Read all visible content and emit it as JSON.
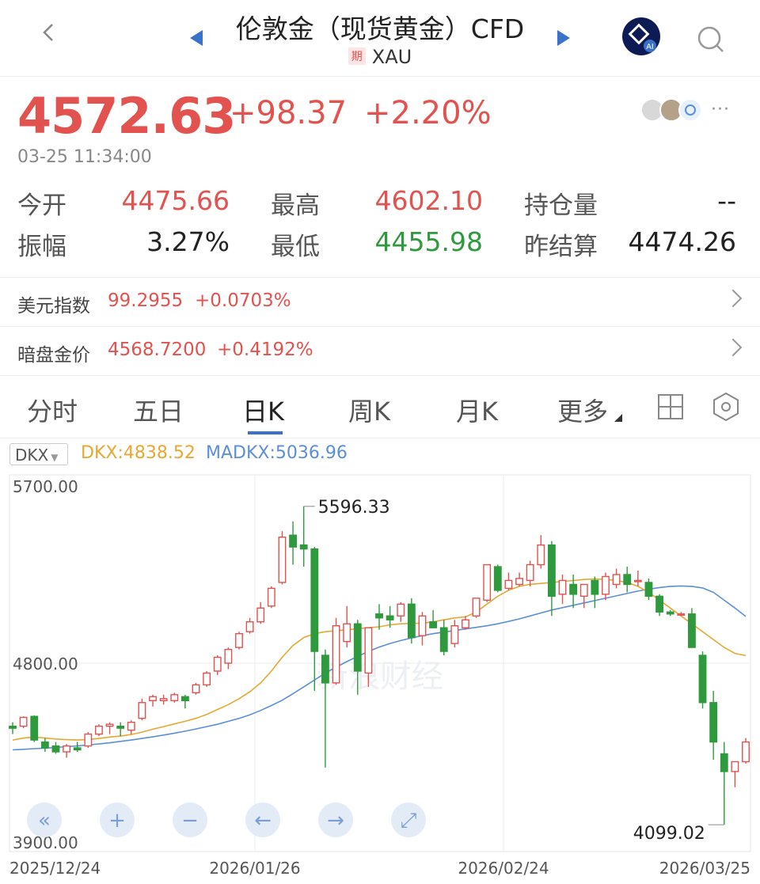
{
  "header": {
    "title": "伦敦金（现货黄金）CFD",
    "badge": "期",
    "symbol": "XAU"
  },
  "quote": {
    "price": "4572.63",
    "change": "+98.37",
    "change_pct": "+2.20%",
    "time": "03-25 11:34:00",
    "more": "···"
  },
  "stats": [
    {
      "label": "今开",
      "value": "4475.66",
      "color": "red"
    },
    {
      "label": "最高",
      "value": "4602.10",
      "color": "red"
    },
    {
      "label": "持仓量",
      "value": "--",
      "color": "blk"
    },
    {
      "label": "振幅",
      "value": "3.27%",
      "color": "blk"
    },
    {
      "label": "最低",
      "value": "4455.98",
      "color": "green"
    },
    {
      "label": "昨结算",
      "value": "4474.26",
      "color": "blk"
    }
  ],
  "related": [
    {
      "label": "美元指数",
      "value": "99.2955",
      "change": "+0.0703%"
    },
    {
      "label": "暗盘金价",
      "value": "4568.7200",
      "change": "+0.4192%"
    }
  ],
  "tabs": [
    "分时",
    "五日",
    "日K",
    "周K",
    "月K",
    "更多"
  ],
  "indicator": {
    "name": "DKX",
    "dkx": "DKX:4838.52",
    "madkx": "MADKX:5036.96"
  },
  "chart_data": {
    "type": "candlestick",
    "ylim": [
      3900,
      5700
    ],
    "y_ticks": [
      "5700.00",
      "4800.00",
      "3900.00"
    ],
    "x_ticks": [
      "2025/12/24",
      "2026/01/26",
      "2026/02/24",
      "2026/03/25"
    ],
    "high_label": "5596.33",
    "low_label": "4099.02",
    "watermark": "新浪财经",
    "candles": [
      [
        4480,
        4500,
        4440,
        4470
      ],
      [
        4480,
        4530,
        4470,
        4525
      ],
      [
        4530,
        4535,
        4400,
        4410
      ],
      [
        4400,
        4420,
        4350,
        4370
      ],
      [
        4380,
        4400,
        4340,
        4350
      ],
      [
        4350,
        4390,
        4320,
        4380
      ],
      [
        4370,
        4400,
        4350,
        4360
      ],
      [
        4380,
        4450,
        4370,
        4440
      ],
      [
        4440,
        4490,
        4430,
        4480
      ],
      [
        4480,
        4500,
        4440,
        4490
      ],
      [
        4480,
        4500,
        4430,
        4470
      ],
      [
        4460,
        4510,
        4440,
        4500
      ],
      [
        4520,
        4620,
        4510,
        4600
      ],
      [
        4610,
        4640,
        4580,
        4630
      ],
      [
        4610,
        4640,
        4590,
        4620
      ],
      [
        4610,
        4650,
        4600,
        4640
      ],
      [
        4630,
        4640,
        4570,
        4610
      ],
      [
        4650,
        4700,
        4640,
        4690
      ],
      [
        4690,
        4760,
        4680,
        4750
      ],
      [
        4760,
        4840,
        4740,
        4830
      ],
      [
        4800,
        4880,
        4770,
        4870
      ],
      [
        4880,
        4960,
        4870,
        4950
      ],
      [
        4960,
        5030,
        4950,
        5010
      ],
      [
        5010,
        5110,
        5000,
        5080
      ],
      [
        5090,
        5190,
        5080,
        5180
      ],
      [
        5210,
        5470,
        5200,
        5440
      ],
      [
        5450,
        5520,
        5300,
        5390
      ],
      [
        5400,
        5596.33,
        5290,
        5380
      ],
      [
        5380,
        5390,
        4660,
        4860
      ],
      [
        4840,
        4870,
        4270,
        4700
      ],
      [
        4700,
        5030,
        4690,
        4990
      ],
      [
        4910,
        5090,
        4880,
        5000
      ],
      [
        5000,
        5020,
        4640,
        4760
      ],
      [
        4750,
        4980,
        4680,
        4980
      ],
      [
        5050,
        5100,
        4970,
        5030
      ],
      [
        5040,
        5090,
        4980,
        5020
      ],
      [
        5040,
        5110,
        5010,
        5100
      ],
      [
        5100,
        5130,
        4900,
        4930
      ],
      [
        4940,
        5060,
        4890,
        5040
      ],
      [
        5010,
        5070,
        4980,
        4980
      ],
      [
        4980,
        5020,
        4840,
        4860
      ],
      [
        4900,
        5020,
        4880,
        4990
      ],
      [
        4980,
        5040,
        4970,
        5020
      ],
      [
        5040,
        5110,
        5030,
        5130
      ],
      [
        5120,
        5300,
        5110,
        5300
      ],
      [
        5290,
        5300,
        5160,
        5170
      ],
      [
        5180,
        5260,
        5170,
        5220
      ],
      [
        5200,
        5260,
        5190,
        5230
      ],
      [
        5220,
        5320,
        5190,
        5300
      ],
      [
        5300,
        5450,
        5280,
        5400
      ],
      [
        5400,
        5420,
        5040,
        5140
      ],
      [
        5150,
        5250,
        5100,
        5220
      ],
      [
        5200,
        5250,
        5080,
        5150
      ],
      [
        5140,
        5200,
        5080,
        5200
      ],
      [
        5220,
        5240,
        5080,
        5150
      ],
      [
        5150,
        5260,
        5120,
        5240
      ],
      [
        5200,
        5280,
        5180,
        5250
      ],
      [
        5250,
        5290,
        5160,
        5200
      ],
      [
        5220,
        5270,
        5190,
        5220
      ],
      [
        5210,
        5230,
        5120,
        5140
      ],
      [
        5140,
        5150,
        5040,
        5060
      ],
      [
        5060,
        5070,
        5040,
        5050
      ],
      [
        5050,
        5060,
        5040,
        5050
      ],
      [
        5050,
        5080,
        4880,
        4880
      ],
      [
        4840,
        4860,
        4570,
        4600
      ],
      [
        4600,
        4660,
        4310,
        4400
      ],
      [
        4340,
        4400,
        3980,
        4250
      ],
      [
        4250,
        4300,
        4170,
        4300
      ],
      [
        4300,
        4420,
        4290,
        4400
      ]
    ],
    "dkx": [
      4410,
      4420,
      4425,
      4420,
      4415,
      4412,
      4410,
      4412,
      4418,
      4425,
      4430,
      4438,
      4450,
      4465,
      4478,
      4492,
      4505,
      4520,
      4540,
      4565,
      4590,
      4620,
      4655,
      4700,
      4760,
      4830,
      4890,
      4930,
      4950,
      4960,
      4965,
      4970,
      4975,
      4980,
      4985,
      4995,
      5000,
      5002,
      5003,
      5010,
      5020,
      5030,
      5035,
      5060,
      5100,
      5140,
      5170,
      5190,
      5200,
      5205,
      5210,
      5215,
      5220,
      5225,
      5228,
      5225,
      5220,
      5210,
      5190,
      5160,
      5120,
      5080,
      5040,
      5000,
      4960,
      4920,
      4880,
      4850,
      4838.52
    ],
    "madkx": [
      4360,
      4363,
      4366,
      4369,
      4372,
      4376,
      4380,
      4385,
      4390,
      4396,
      4403,
      4410,
      4418,
      4426,
      4435,
      4445,
      4455,
      4466,
      4478,
      4490,
      4505,
      4520,
      4538,
      4560,
      4585,
      4612,
      4645,
      4680,
      4715,
      4750,
      4780,
      4808,
      4835,
      4860,
      4882,
      4900,
      4915,
      4928,
      4940,
      4950,
      4958,
      4966,
      4974,
      4982,
      4990,
      5000,
      5012,
      5025,
      5040,
      5055,
      5070,
      5082,
      5094,
      5106,
      5118,
      5130,
      5142,
      5154,
      5166,
      5176,
      5184,
      5190,
      5192,
      5190,
      5182,
      5160,
      5120,
      5080,
      5036.96
    ]
  },
  "chart_controls": [
    "«",
    "+",
    "−",
    "←",
    "→",
    "⤢"
  ],
  "colors": {
    "up": "#e2524f",
    "down": "#2f9a3d",
    "dkx": "#e7a832",
    "madkx": "#5b8fd8",
    "accent": "#3a72c9"
  }
}
